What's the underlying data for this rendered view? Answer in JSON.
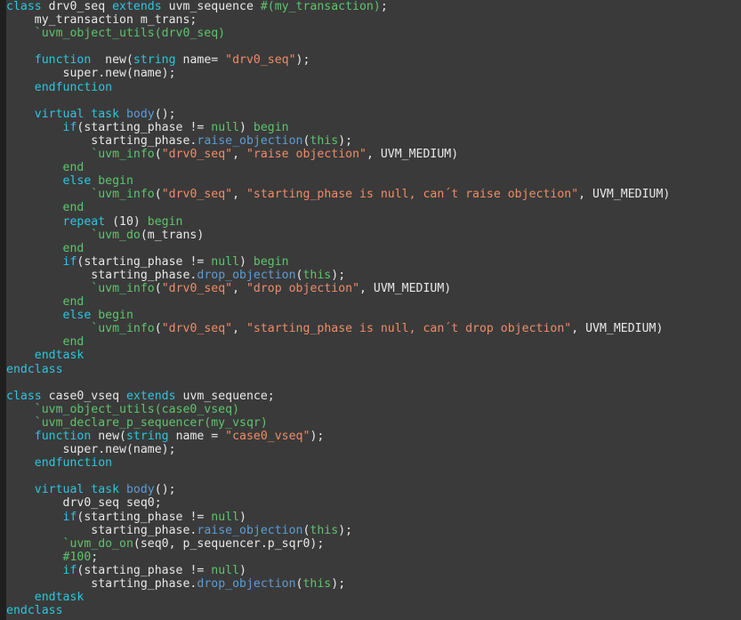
{
  "editor": {
    "language": "SystemVerilog",
    "background_color": "#3a3a3a",
    "gutter_color": "#1f1f1f",
    "plain_color": "#e8e8e8",
    "keyword_color": "#2ac7e0",
    "identifier_color": "#5ec46c",
    "string_color": "#ef8c66",
    "method_color": "#5d9cd4"
  },
  "code": {
    "lines": [
      [
        {
          "t": "class ",
          "c": "kw"
        },
        {
          "t": "drv0_seq ",
          "c": "pl"
        },
        {
          "t": "extends",
          "c": "kw"
        },
        {
          "t": " uvm_sequence ",
          "c": "pl"
        },
        {
          "t": "#(my_transaction)",
          "c": "id"
        },
        {
          "t": ";",
          "c": "pl"
        }
      ],
      [
        {
          "t": "    my_transaction m_trans;",
          "c": "pl"
        }
      ],
      [
        {
          "t": "    `uvm_object_utils(drv0_seq)",
          "c": "id"
        }
      ],
      [
        {
          "t": "",
          "c": "pl"
        }
      ],
      [
        {
          "t": "    function",
          "c": "kw"
        },
        {
          "t": "  new(",
          "c": "pl"
        },
        {
          "t": "string",
          "c": "kw"
        },
        {
          "t": " name= ",
          "c": "pl"
        },
        {
          "t": "\"drv0_seq\"",
          "c": "str"
        },
        {
          "t": ");",
          "c": "pl"
        }
      ],
      [
        {
          "t": "        super.new(name);",
          "c": "pl"
        }
      ],
      [
        {
          "t": "    endfunction",
          "c": "kw"
        }
      ],
      [
        {
          "t": "",
          "c": "pl"
        }
      ],
      [
        {
          "t": "    virtual task ",
          "c": "kw"
        },
        {
          "t": "body",
          "c": "mth"
        },
        {
          "t": "();",
          "c": "pl"
        }
      ],
      [
        {
          "t": "        if",
          "c": "kw"
        },
        {
          "t": "(starting_phase != ",
          "c": "pl"
        },
        {
          "t": "null",
          "c": "id"
        },
        {
          "t": ") ",
          "c": "pl"
        },
        {
          "t": "begin",
          "c": "id"
        }
      ],
      [
        {
          "t": "            starting_phase.",
          "c": "pl"
        },
        {
          "t": "raise_objection",
          "c": "mth"
        },
        {
          "t": "(",
          "c": "pl"
        },
        {
          "t": "this",
          "c": "id"
        },
        {
          "t": ");",
          "c": "pl"
        }
      ],
      [
        {
          "t": "            `uvm_info",
          "c": "id"
        },
        {
          "t": "(",
          "c": "pl"
        },
        {
          "t": "\"drv0_seq\"",
          "c": "str"
        },
        {
          "t": ", ",
          "c": "pl"
        },
        {
          "t": "\"raise objection\"",
          "c": "str"
        },
        {
          "t": ", UVM_MEDIUM)",
          "c": "pl"
        }
      ],
      [
        {
          "t": "        end",
          "c": "id"
        }
      ],
      [
        {
          "t": "        else ",
          "c": "kw"
        },
        {
          "t": "begin",
          "c": "id"
        }
      ],
      [
        {
          "t": "            `uvm_info",
          "c": "id"
        },
        {
          "t": "(",
          "c": "pl"
        },
        {
          "t": "\"drv0_seq\"",
          "c": "str"
        },
        {
          "t": ", ",
          "c": "pl"
        },
        {
          "t": "\"starting_phase is null, can´t raise objection\"",
          "c": "str"
        },
        {
          "t": ", UVM_MEDIUM)",
          "c": "pl"
        }
      ],
      [
        {
          "t": "        end",
          "c": "id"
        }
      ],
      [
        {
          "t": "        repeat",
          "c": "kw"
        },
        {
          "t": " (10) ",
          "c": "pl"
        },
        {
          "t": "begin",
          "c": "id"
        }
      ],
      [
        {
          "t": "            `uvm_do",
          "c": "id"
        },
        {
          "t": "(m_trans)",
          "c": "pl"
        }
      ],
      [
        {
          "t": "        end",
          "c": "id"
        }
      ],
      [
        {
          "t": "        if",
          "c": "kw"
        },
        {
          "t": "(starting_phase != ",
          "c": "pl"
        },
        {
          "t": "null",
          "c": "id"
        },
        {
          "t": ") ",
          "c": "pl"
        },
        {
          "t": "begin",
          "c": "id"
        }
      ],
      [
        {
          "t": "            starting_phase.",
          "c": "pl"
        },
        {
          "t": "drop_objection",
          "c": "mth"
        },
        {
          "t": "(",
          "c": "pl"
        },
        {
          "t": "this",
          "c": "id"
        },
        {
          "t": ");",
          "c": "pl"
        }
      ],
      [
        {
          "t": "            `uvm_info",
          "c": "id"
        },
        {
          "t": "(",
          "c": "pl"
        },
        {
          "t": "\"drv0_seq\"",
          "c": "str"
        },
        {
          "t": ", ",
          "c": "pl"
        },
        {
          "t": "\"drop objection\"",
          "c": "str"
        },
        {
          "t": ", UVM_MEDIUM)",
          "c": "pl"
        }
      ],
      [
        {
          "t": "        end",
          "c": "id"
        }
      ],
      [
        {
          "t": "        else ",
          "c": "kw"
        },
        {
          "t": "begin",
          "c": "id"
        }
      ],
      [
        {
          "t": "            `uvm_info",
          "c": "id"
        },
        {
          "t": "(",
          "c": "pl"
        },
        {
          "t": "\"drv0_seq\"",
          "c": "str"
        },
        {
          "t": ", ",
          "c": "pl"
        },
        {
          "t": "\"starting_phase is null, can´t drop objection\"",
          "c": "str"
        },
        {
          "t": ", UVM_MEDIUM)",
          "c": "pl"
        }
      ],
      [
        {
          "t": "        end",
          "c": "id"
        }
      ],
      [
        {
          "t": "    endtask",
          "c": "kw"
        }
      ],
      [
        {
          "t": "endclass",
          "c": "kw"
        }
      ],
      [
        {
          "t": "",
          "c": "pl"
        }
      ],
      [
        {
          "t": "class ",
          "c": "kw"
        },
        {
          "t": "case0_vseq ",
          "c": "pl"
        },
        {
          "t": "extends",
          "c": "kw"
        },
        {
          "t": " uvm_sequence;",
          "c": "pl"
        }
      ],
      [
        {
          "t": "    `uvm_object_utils(case0_vseq)",
          "c": "id"
        }
      ],
      [
        {
          "t": "    `uvm_declare_p_sequencer(my_vsqr)",
          "c": "id"
        }
      ],
      [
        {
          "t": "    function",
          "c": "kw"
        },
        {
          "t": " new(",
          "c": "pl"
        },
        {
          "t": "string",
          "c": "kw"
        },
        {
          "t": " name = ",
          "c": "pl"
        },
        {
          "t": "\"case0_vseq\"",
          "c": "str"
        },
        {
          "t": ");",
          "c": "pl"
        }
      ],
      [
        {
          "t": "        super.new(name);",
          "c": "pl"
        }
      ],
      [
        {
          "t": "    endfunction",
          "c": "kw"
        }
      ],
      [
        {
          "t": "",
          "c": "pl"
        }
      ],
      [
        {
          "t": "    virtual task ",
          "c": "kw"
        },
        {
          "t": "body",
          "c": "mth"
        },
        {
          "t": "();",
          "c": "pl"
        }
      ],
      [
        {
          "t": "        drv0_seq seq0;",
          "c": "pl"
        }
      ],
      [
        {
          "t": "        if",
          "c": "kw"
        },
        {
          "t": "(starting_phase != ",
          "c": "pl"
        },
        {
          "t": "null",
          "c": "id"
        },
        {
          "t": ")",
          "c": "pl"
        }
      ],
      [
        {
          "t": "            starting_phase.",
          "c": "pl"
        },
        {
          "t": "raise_objection",
          "c": "mth"
        },
        {
          "t": "(",
          "c": "pl"
        },
        {
          "t": "this",
          "c": "id"
        },
        {
          "t": ");",
          "c": "pl"
        }
      ],
      [
        {
          "t": "        `uvm_do_on",
          "c": "id"
        },
        {
          "t": "(seq0, p_sequencer.p_sqr0);",
          "c": "pl"
        }
      ],
      [
        {
          "t": "        #100",
          "c": "id"
        },
        {
          "t": ";",
          "c": "pl"
        }
      ],
      [
        {
          "t": "        if",
          "c": "kw"
        },
        {
          "t": "(starting_phase != ",
          "c": "pl"
        },
        {
          "t": "null",
          "c": "id"
        },
        {
          "t": ")",
          "c": "pl"
        }
      ],
      [
        {
          "t": "            starting_phase.",
          "c": "pl"
        },
        {
          "t": "drop_objection",
          "c": "mth"
        },
        {
          "t": "(",
          "c": "pl"
        },
        {
          "t": "this",
          "c": "id"
        },
        {
          "t": ");",
          "c": "pl"
        }
      ],
      [
        {
          "t": "    endtask",
          "c": "kw"
        }
      ],
      [
        {
          "t": "endclass",
          "c": "kw"
        }
      ]
    ]
  }
}
